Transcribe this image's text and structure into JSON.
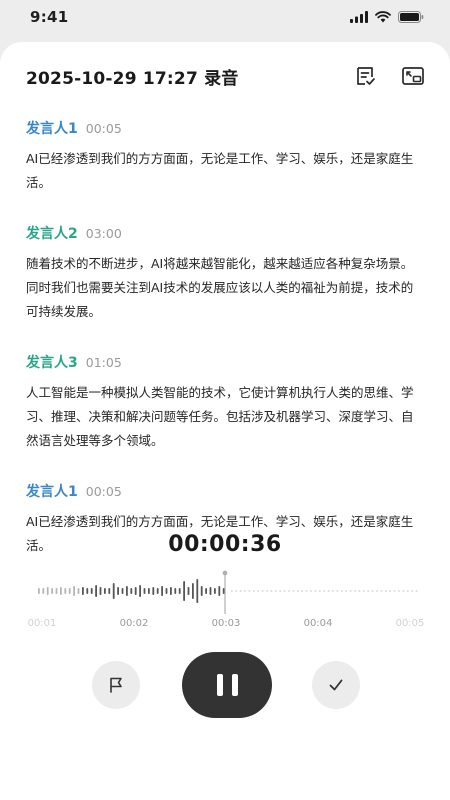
{
  "status_bar": {
    "time": "9:41"
  },
  "header": {
    "title": "2025-10-29 17:27 录音"
  },
  "transcript": [
    {
      "speaker": "发言人1",
      "time": "00:05",
      "color": "#3a87c7",
      "text": "AI已经渗透到我们的方方面面，无论是工作、学习、娱乐，还是家庭生活。"
    },
    {
      "speaker": "发言人2",
      "time": "03:00",
      "color": "#2aa48a",
      "text": "随着技术的不断进步，AI将越来越智能化，越来越适应各种复杂场景。同时我们也需要关注到AI技术的发展应该以人类的福祉为前提，技术的可持续发展。"
    },
    {
      "speaker": "发言人3",
      "time": "01:05",
      "color": "#2aa48a",
      "text": "人工智能是一种模拟人类智能的技术，它使计算机执行人类的思维、学习、推理、决策和解决问题等任务。包括涉及机器学习、深度学习、自然语言处理等多个领域。"
    },
    {
      "speaker": "发言人1",
      "time": "00:05",
      "color": "#3a87c7",
      "text": "AI已经渗透到我们的方方面面，无论是工作、学习、娱乐，还是家庭生活。"
    }
  ],
  "recorder": {
    "elapsed": "00:00:36",
    "ticks": [
      "00:01",
      "00:02",
      "00:03",
      "00:04",
      "00:05"
    ]
  },
  "controls": {
    "flag_icon": "flag-icon",
    "pause_icon": "pause-icon",
    "done_icon": "check-icon"
  }
}
